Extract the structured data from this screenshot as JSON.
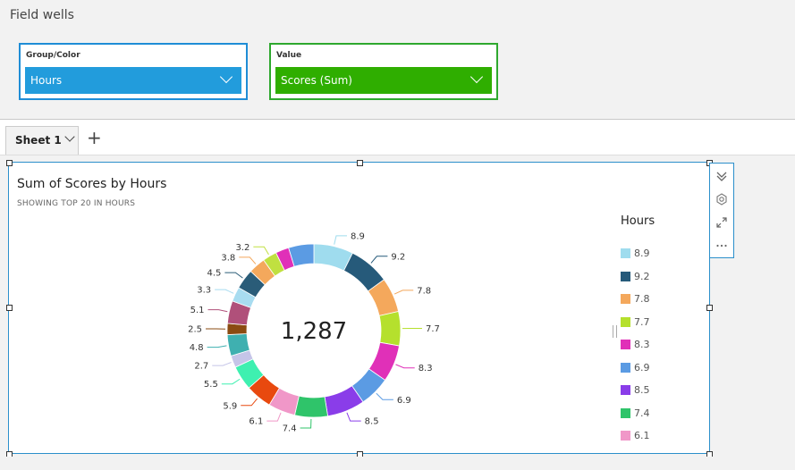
{
  "field_wells": {
    "title": "Field wells",
    "group_color": {
      "label": "Group/Color",
      "value": "Hours"
    },
    "value": {
      "label": "Value",
      "value": "Scores (Sum)"
    }
  },
  "sheet_tab": {
    "label": "Sheet 1"
  },
  "visual": {
    "title": "Sum of Scores by Hours",
    "subtitle": "SHOWING TOP 20 IN HOURS",
    "center_value": "1,287"
  },
  "legend": {
    "title": "Hours",
    "items": [
      {
        "label": "8.9",
        "color": "#9fdcee"
      },
      {
        "label": "9.2",
        "color": "#265a7a"
      },
      {
        "label": "7.8",
        "color": "#f4a85c"
      },
      {
        "label": "7.7",
        "color": "#b5e02d"
      },
      {
        "label": "8.3",
        "color": "#e030b8"
      },
      {
        "label": "6.9",
        "color": "#5b9be3"
      },
      {
        "label": "8.5",
        "color": "#8a3de9"
      },
      {
        "label": "7.4",
        "color": "#2fc46a"
      },
      {
        "label": "6.1",
        "color": "#f097c8"
      }
    ]
  },
  "chart_data": {
    "type": "pie",
    "variant": "donut",
    "title": "Sum of Scores by Hours",
    "subtitle": "SHOWING TOP 20 IN HOURS",
    "center_label": "1,287",
    "legend_title": "Hours",
    "legend_position": "right",
    "slices": [
      {
        "label": "8.9",
        "value": 89,
        "color": "#9fdcee"
      },
      {
        "label": "9.2",
        "value": 92,
        "color": "#265a7a"
      },
      {
        "label": "7.8",
        "value": 78,
        "color": "#f4a85c"
      },
      {
        "label": "7.7",
        "value": 77,
        "color": "#b5e02d"
      },
      {
        "label": "8.3",
        "value": 83,
        "color": "#e030b8"
      },
      {
        "label": "6.9",
        "value": 69,
        "color": "#5b9be3"
      },
      {
        "label": "8.5",
        "value": 85,
        "color": "#8a3de9"
      },
      {
        "label": "7.4",
        "value": 74,
        "color": "#2fc46a"
      },
      {
        "label": "6.1",
        "value": 61,
        "color": "#f097c8"
      },
      {
        "label": "5.9",
        "value": 59,
        "color": "#e8490f"
      },
      {
        "label": "5.5",
        "value": 55,
        "color": "#3ef0b0"
      },
      {
        "label": "2.7",
        "value": 27,
        "color": "#c5c5e8"
      },
      {
        "label": "4.8",
        "value": 48,
        "color": "#3fb0b0"
      },
      {
        "label": "2.5",
        "value": 25,
        "color": "#8b4b12"
      },
      {
        "label": "5.1",
        "value": 51,
        "color": "#b0507a"
      },
      {
        "label": "3.3",
        "value": 33,
        "color": "#a8dcf0"
      },
      {
        "label": "4.5",
        "value": 45,
        "color": "#2a5c78"
      },
      {
        "label": "3.8",
        "value": 38,
        "color": "#f4a85c"
      },
      {
        "label": "3.2",
        "value": 32,
        "color": "#c0e040"
      },
      {
        "label": "(slice)",
        "value": 30,
        "color": "#e030b8"
      },
      {
        "label": "(slice)",
        "value": 57,
        "color": "#5b9be3"
      }
    ]
  },
  "icons": {
    "collapse": "double-chevron-down-icon",
    "settings": "gear-icon",
    "expand": "expand-icon",
    "more": "ellipsis-icon",
    "add": "plus-icon"
  }
}
